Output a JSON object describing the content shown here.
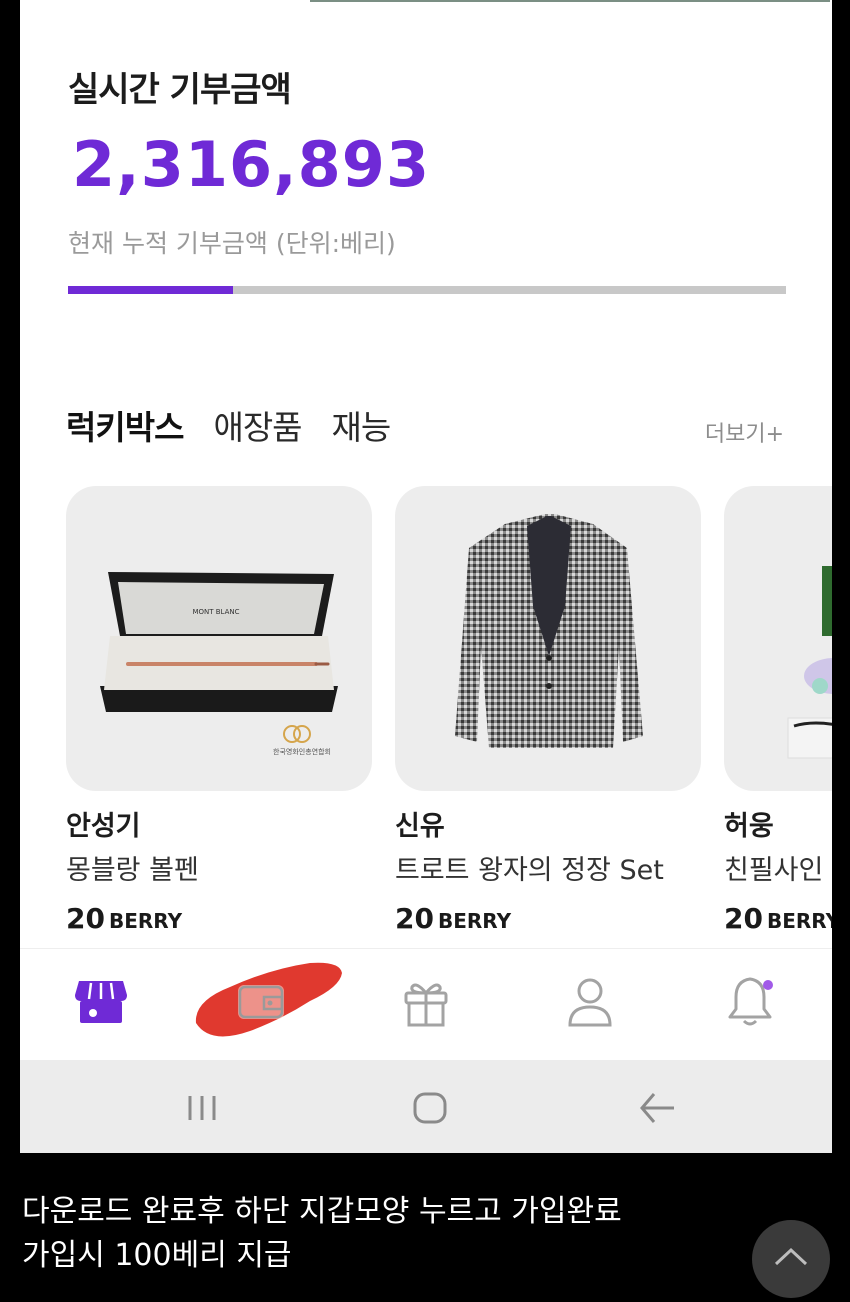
{
  "donation": {
    "title": "실시간 기부금액",
    "amount": "2,316,893",
    "subtitle": "현재 누적 기부금액 (단위:베리)",
    "progress": 0.23
  },
  "tabs": [
    {
      "label": "럭키박스",
      "active": true
    },
    {
      "label": "애장품",
      "active": false
    },
    {
      "label": "재능",
      "active": false
    }
  ],
  "more_label": "더보기+",
  "products": [
    {
      "name": "안성기",
      "item": "몽블랑 볼펜",
      "price": "20",
      "unit": "BERRY",
      "image_text": "MONT BLANC",
      "logo_text": "한국영화인총연합회"
    },
    {
      "name": "신유",
      "item": "트로트 왕자의  정장 Set",
      "price": "20",
      "unit": "BERRY"
    },
    {
      "name": "허웅",
      "item": "친필사인 ...",
      "price": "20",
      "unit": "BERRY"
    }
  ],
  "bottom_nav": [
    {
      "icon": "store-icon",
      "active": true
    },
    {
      "icon": "wallet-icon",
      "active": false
    },
    {
      "icon": "gift-icon",
      "active": false
    },
    {
      "icon": "profile-icon",
      "active": false
    },
    {
      "icon": "bell-icon",
      "active": false,
      "badge": true
    }
  ],
  "colors": {
    "accent": "#6f2ad6",
    "highlight": "#e0392f"
  },
  "caption": {
    "line1": "다운로드 완료후 하단 지갑모양 누르고 가입완료",
    "line2": "가입시 100베리 지급"
  }
}
